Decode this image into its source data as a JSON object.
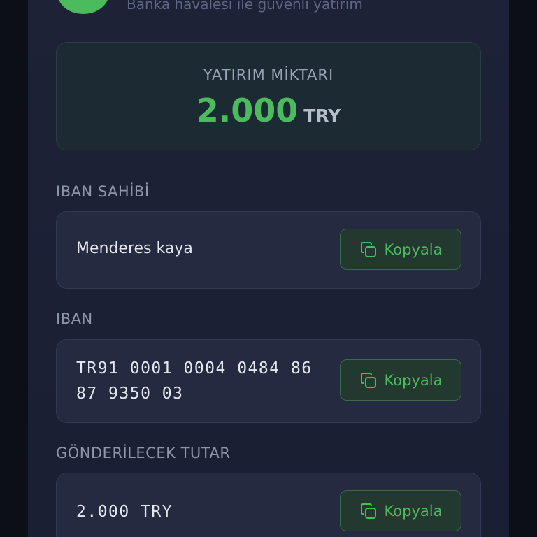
{
  "header": {
    "subtitle": "Banka havalesi ile güvenli yatırım"
  },
  "amount": {
    "label": "YATIRIM MİKTARI",
    "value": "2.000",
    "currency": "TRY"
  },
  "fields": {
    "holder": {
      "label": "IBAN SAHİBİ",
      "value": "Menderes kaya",
      "copy_label": "Kopyala"
    },
    "iban": {
      "label": "IBAN",
      "line1": "TR91 0001 0004 0484 86",
      "line2": "87 9350 03",
      "copy_label": "Kopyala"
    },
    "send_amount": {
      "label": "GÖNDERİLECEK TUTAR",
      "value": "2.000 TRY",
      "copy_label": "Kopyala"
    }
  },
  "colors": {
    "accent": "#4cbb5e",
    "background": "#1d2237",
    "card": "#242a3f",
    "amount_card": "#1c2a33"
  },
  "icons": {
    "copy": "copy-icon"
  }
}
